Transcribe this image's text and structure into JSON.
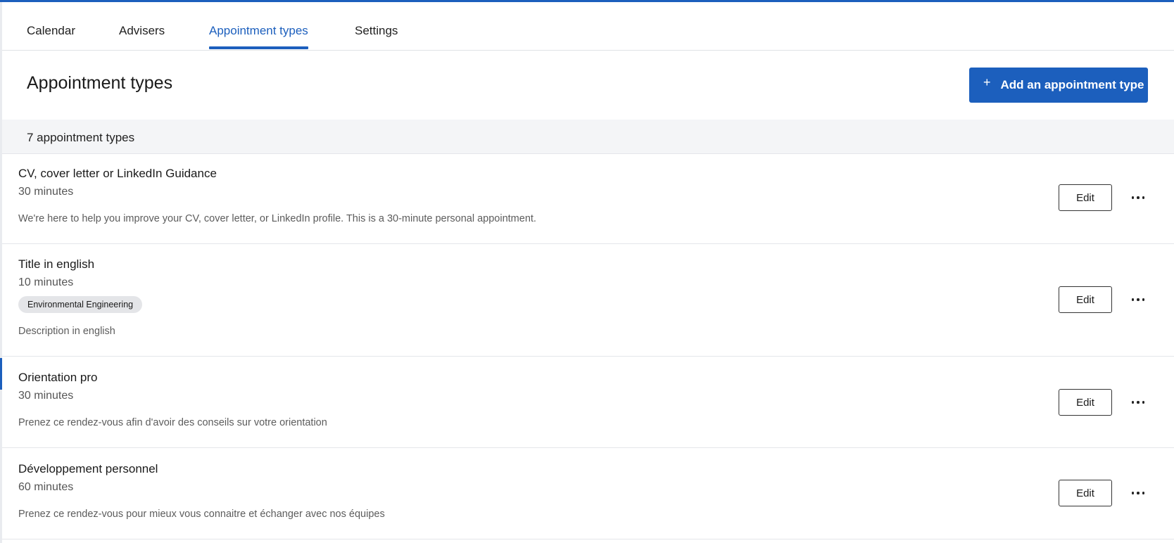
{
  "tabs": [
    {
      "label": "Calendar",
      "active": false
    },
    {
      "label": "Advisers",
      "active": false
    },
    {
      "label": "Appointment types",
      "active": true
    },
    {
      "label": "Settings",
      "active": false
    }
  ],
  "header": {
    "title": "Appointment types",
    "add_button_label": "Add an appointment type",
    "add_button_icon": "plus-icon"
  },
  "summary": {
    "count_text": "7 appointment types"
  },
  "appointment_types": [
    {
      "title": "CV, cover letter or LinkedIn Guidance",
      "duration": "30 minutes",
      "tag": null,
      "description": "We're here to help you improve your CV, cover letter, or LinkedIn profile. This is a 30-minute personal appointment.",
      "edit_label": "Edit"
    },
    {
      "title": "Title in english",
      "duration": "10 minutes",
      "tag": "Environmental Engineering",
      "description": "Description in english",
      "edit_label": "Edit"
    },
    {
      "title": "Orientation pro",
      "duration": "30 minutes",
      "tag": null,
      "description": "Prenez ce rendez-vous afin d'avoir des conseils sur votre orientation",
      "edit_label": "Edit"
    },
    {
      "title": "Développement personnel",
      "duration": "60 minutes",
      "tag": null,
      "description": "Prenez ce rendez-vous pour mieux vous connaitre et échanger avec nos équipes",
      "edit_label": "Edit"
    }
  ],
  "colors": {
    "accent": "#1c5fbd",
    "row_border": "#e4e6ea",
    "summary_background": "#f4f5f7",
    "tag_background": "#e4e5e8"
  }
}
